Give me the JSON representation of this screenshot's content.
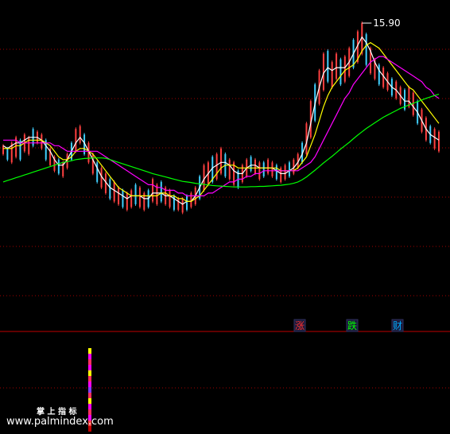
{
  "chart_data": {
    "type": "line",
    "price_ylim": [
      8.0,
      16.5
    ],
    "peak_label": "15.90",
    "candles": [
      [
        11.2,
        11.5
      ],
      [
        11.0,
        11.4
      ],
      [
        10.9,
        11.6
      ],
      [
        11.1,
        11.8
      ],
      [
        11.0,
        11.7
      ],
      [
        11.3,
        11.9
      ],
      [
        11.2,
        11.8
      ],
      [
        11.5,
        12.1
      ],
      [
        11.6,
        12.0
      ],
      [
        11.4,
        11.9
      ],
      [
        11.0,
        11.7
      ],
      [
        10.8,
        11.4
      ],
      [
        10.6,
        11.1
      ],
      [
        10.5,
        11.0
      ],
      [
        10.4,
        10.9
      ],
      [
        10.7,
        11.2
      ],
      [
        11.0,
        11.6
      ],
      [
        11.3,
        12.1
      ],
      [
        11.6,
        12.2
      ],
      [
        11.2,
        11.9
      ],
      [
        10.9,
        11.6
      ],
      [
        10.5,
        11.2
      ],
      [
        10.2,
        10.9
      ],
      [
        10.0,
        10.7
      ],
      [
        9.8,
        10.5
      ],
      [
        9.6,
        10.3
      ],
      [
        9.5,
        10.2
      ],
      [
        9.4,
        10.0
      ],
      [
        9.3,
        9.9
      ],
      [
        9.2,
        9.8
      ],
      [
        9.3,
        9.9
      ],
      [
        9.4,
        10.1
      ],
      [
        9.3,
        10.0
      ],
      [
        9.2,
        9.8
      ],
      [
        9.3,
        9.9
      ],
      [
        9.5,
        10.3
      ],
      [
        9.4,
        10.1
      ],
      [
        9.5,
        10.2
      ],
      [
        9.4,
        10.0
      ],
      [
        9.3,
        9.9
      ],
      [
        9.2,
        9.7
      ],
      [
        9.2,
        9.6
      ],
      [
        9.1,
        9.6
      ],
      [
        9.2,
        9.7
      ],
      [
        9.3,
        9.8
      ],
      [
        9.4,
        10.0
      ],
      [
        9.6,
        10.4
      ],
      [
        9.9,
        10.8
      ],
      [
        10.1,
        10.9
      ],
      [
        10.2,
        11.1
      ],
      [
        10.3,
        11.2
      ],
      [
        10.5,
        11.4
      ],
      [
        10.4,
        11.2
      ],
      [
        10.3,
        11.0
      ],
      [
        10.1,
        10.9
      ],
      [
        10.0,
        10.6
      ],
      [
        10.2,
        10.8
      ],
      [
        10.4,
        11.0
      ],
      [
        10.6,
        11.1
      ],
      [
        10.5,
        11.0
      ],
      [
        10.3,
        10.9
      ],
      [
        10.4,
        10.9
      ],
      [
        10.5,
        11.0
      ],
      [
        10.4,
        10.9
      ],
      [
        10.3,
        10.8
      ],
      [
        10.2,
        10.7
      ],
      [
        10.3,
        10.8
      ],
      [
        10.4,
        10.9
      ],
      [
        10.5,
        11.0
      ],
      [
        10.7,
        11.2
      ],
      [
        10.9,
        11.6
      ],
      [
        11.2,
        12.3
      ],
      [
        11.8,
        13.1
      ],
      [
        12.4,
        13.7
      ],
      [
        13.0,
        14.2
      ],
      [
        13.5,
        14.8
      ],
      [
        13.8,
        14.9
      ],
      [
        13.6,
        14.5
      ],
      [
        13.9,
        14.8
      ],
      [
        13.7,
        14.6
      ],
      [
        13.8,
        14.7
      ],
      [
        14.0,
        15.0
      ],
      [
        14.3,
        15.3
      ],
      [
        14.5,
        15.6
      ],
      [
        14.8,
        15.9
      ],
      [
        14.4,
        15.5
      ],
      [
        14.1,
        15.0
      ],
      [
        13.9,
        14.6
      ],
      [
        13.7,
        14.4
      ],
      [
        13.6,
        14.3
      ],
      [
        13.5,
        14.1
      ],
      [
        13.3,
        13.9
      ],
      [
        13.2,
        13.8
      ],
      [
        13.0,
        13.6
      ],
      [
        12.8,
        13.5
      ],
      [
        12.9,
        13.6
      ],
      [
        12.6,
        13.4
      ],
      [
        12.3,
        13.1
      ],
      [
        12.0,
        12.8
      ],
      [
        11.7,
        12.5
      ],
      [
        11.6,
        12.2
      ],
      [
        11.4,
        12.1
      ],
      [
        11.3,
        12.0
      ]
    ],
    "series": [
      {
        "color": "#ffffff",
        "values": [
          11.5,
          11.4,
          11.5,
          11.6,
          11.6,
          11.7,
          11.8,
          11.8,
          11.8,
          11.7,
          11.5,
          11.3,
          11.0,
          10.8,
          10.8,
          11.0,
          11.3,
          11.6,
          11.8,
          11.6,
          11.3,
          11.0,
          10.7,
          10.4,
          10.2,
          10.0,
          9.9,
          9.8,
          9.7,
          9.6,
          9.7,
          9.7,
          9.7,
          9.6,
          9.6,
          9.8,
          9.8,
          9.8,
          9.7,
          9.7,
          9.6,
          9.5,
          9.4,
          9.5,
          9.5,
          9.7,
          10.0,
          10.3,
          10.5,
          10.7,
          10.8,
          10.9,
          10.9,
          10.8,
          10.6,
          10.5,
          10.5,
          10.7,
          10.8,
          10.8,
          10.7,
          10.7,
          10.7,
          10.7,
          10.6,
          10.5,
          10.5,
          10.6,
          10.7,
          10.9,
          11.2,
          11.6,
          12.3,
          13.0,
          13.6,
          14.1,
          14.3,
          14.2,
          14.3,
          14.3,
          14.3,
          14.5,
          14.8,
          15.1,
          15.4,
          15.2,
          14.9,
          14.5,
          14.2,
          14.0,
          13.8,
          13.6,
          13.5,
          13.3,
          13.1,
          13.1,
          12.9,
          12.7,
          12.4,
          12.1,
          11.9,
          11.8,
          11.7
        ]
      },
      {
        "color": "#ffff00",
        "values": [
          11.4,
          11.4,
          11.4,
          11.5,
          11.5,
          11.6,
          11.7,
          11.7,
          11.7,
          11.7,
          11.6,
          11.5,
          11.3,
          11.1,
          11.0,
          11.0,
          11.1,
          11.3,
          11.4,
          11.4,
          11.3,
          11.2,
          11.0,
          10.8,
          10.6,
          10.4,
          10.2,
          10.0,
          9.9,
          9.8,
          9.7,
          9.7,
          9.7,
          9.7,
          9.7,
          9.7,
          9.7,
          9.8,
          9.8,
          9.7,
          9.7,
          9.6,
          9.6,
          9.5,
          9.5,
          9.6,
          9.7,
          9.9,
          10.1,
          10.3,
          10.5,
          10.7,
          10.8,
          10.8,
          10.8,
          10.7,
          10.7,
          10.7,
          10.7,
          10.7,
          10.7,
          10.7,
          10.7,
          10.7,
          10.7,
          10.6,
          10.6,
          10.6,
          10.6,
          10.7,
          10.9,
          11.1,
          11.5,
          11.9,
          12.4,
          12.9,
          13.3,
          13.6,
          13.8,
          14.0,
          14.2,
          14.3,
          14.4,
          14.6,
          14.9,
          15.1,
          15.2,
          15.1,
          15.0,
          14.8,
          14.6,
          14.4,
          14.2,
          14.0,
          13.8,
          13.6,
          13.5,
          13.3,
          13.1,
          12.9,
          12.7,
          12.5,
          12.3
        ]
      },
      {
        "color": "#ff00ff",
        "values": [
          11.7,
          11.7,
          11.7,
          11.7,
          11.6,
          11.6,
          11.6,
          11.6,
          11.6,
          11.6,
          11.6,
          11.6,
          11.5,
          11.5,
          11.4,
          11.3,
          11.3,
          11.3,
          11.3,
          11.3,
          11.3,
          11.3,
          11.3,
          11.2,
          11.1,
          11.0,
          10.9,
          10.8,
          10.7,
          10.6,
          10.5,
          10.4,
          10.3,
          10.2,
          10.1,
          10.1,
          10.0,
          10.0,
          9.9,
          9.9,
          9.9,
          9.8,
          9.8,
          9.7,
          9.7,
          9.7,
          9.7,
          9.7,
          9.8,
          9.8,
          9.9,
          10.0,
          10.1,
          10.2,
          10.2,
          10.3,
          10.3,
          10.4,
          10.4,
          10.5,
          10.5,
          10.6,
          10.6,
          10.6,
          10.6,
          10.6,
          10.6,
          10.6,
          10.6,
          10.6,
          10.7,
          10.8,
          10.9,
          11.1,
          11.4,
          11.7,
          12.0,
          12.3,
          12.6,
          12.9,
          13.2,
          13.4,
          13.7,
          13.9,
          14.1,
          14.3,
          14.5,
          14.6,
          14.7,
          14.7,
          14.6,
          14.5,
          14.4,
          14.3,
          14.2,
          14.1,
          14.0,
          13.9,
          13.8,
          13.6,
          13.5,
          13.3,
          13.2
        ]
      },
      {
        "color": "#00ff00",
        "values": [
          10.2,
          10.25,
          10.3,
          10.35,
          10.4,
          10.45,
          10.5,
          10.55,
          10.6,
          10.65,
          10.7,
          10.75,
          10.8,
          10.85,
          10.9,
          10.93,
          10.96,
          11.0,
          11.02,
          11.04,
          11.05,
          11.06,
          11.06,
          11.06,
          11.05,
          11.0,
          10.95,
          10.9,
          10.85,
          10.8,
          10.75,
          10.7,
          10.65,
          10.6,
          10.55,
          10.5,
          10.46,
          10.42,
          10.38,
          10.34,
          10.3,
          10.26,
          10.22,
          10.2,
          10.18,
          10.15,
          10.13,
          10.11,
          10.09,
          10.07,
          10.06,
          10.05,
          10.04,
          10.03,
          10.02,
          10.02,
          10.02,
          10.02,
          10.03,
          10.03,
          10.04,
          10.04,
          10.05,
          10.06,
          10.07,
          10.08,
          10.1,
          10.12,
          10.15,
          10.2,
          10.28,
          10.38,
          10.5,
          10.62,
          10.75,
          10.88,
          11.0,
          11.12,
          11.25,
          11.38,
          11.5,
          11.62,
          11.75,
          11.88,
          12.0,
          12.12,
          12.22,
          12.32,
          12.42,
          12.52,
          12.6,
          12.68,
          12.76,
          12.84,
          12.9,
          12.96,
          13.02,
          13.08,
          13.14,
          13.2,
          13.25,
          13.3,
          13.35
        ]
      }
    ],
    "signals": [
      {
        "text": "涨",
        "color": "#ff3030"
      },
      {
        "text": "跌",
        "color": "#00ff00"
      },
      {
        "text": "财",
        "color": "#00aaff"
      }
    ]
  },
  "footer": {
    "indicator_name": "掌 上 指 标",
    "website": "www.palmindex.com"
  }
}
